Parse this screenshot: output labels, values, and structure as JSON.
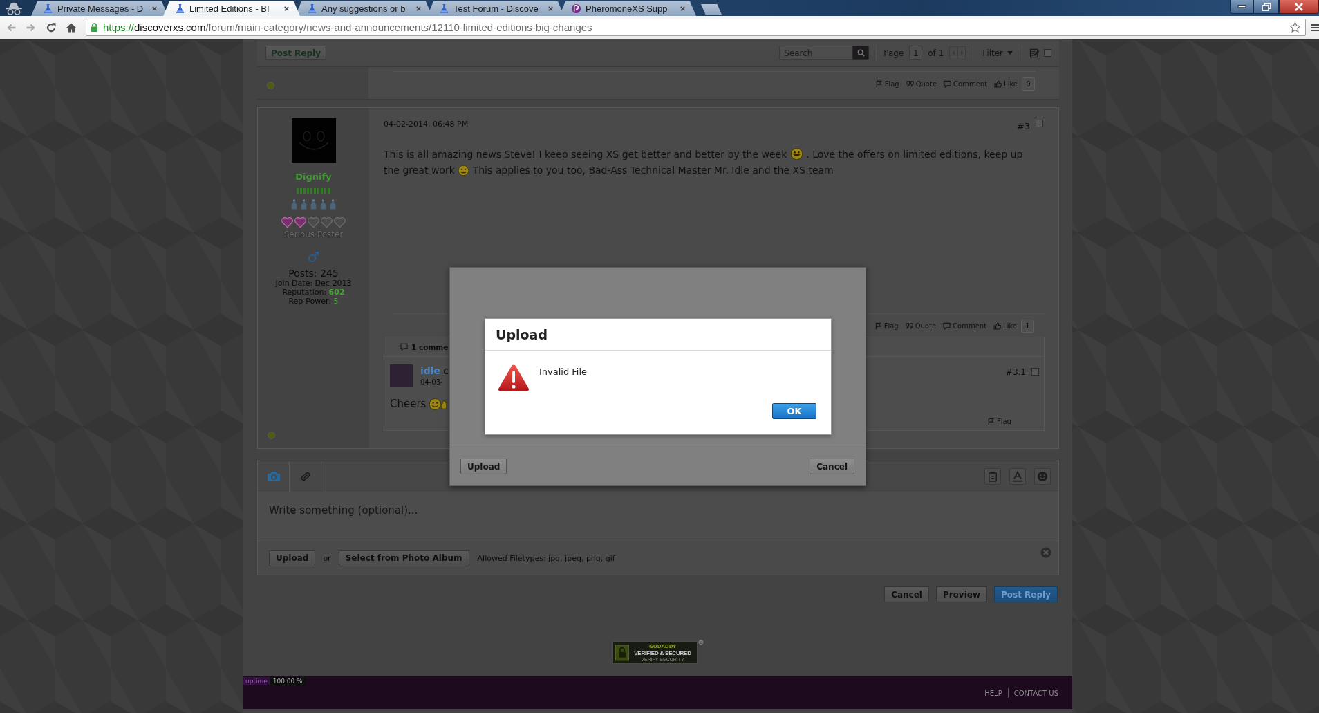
{
  "browser": {
    "tabs": [
      {
        "title": "Private Messages - D",
        "selected": false
      },
      {
        "title": "Limited Editions - BI",
        "selected": true
      },
      {
        "title": "Any suggestions or b",
        "selected": false
      },
      {
        "title": "Test Forum - Discove",
        "selected": false
      },
      {
        "title": "PheromoneXS Supp",
        "selected": false
      }
    ],
    "address": {
      "scheme": "https://",
      "host": "discoverxs.com",
      "path": "/forum/main-category/news-and-announcements/12110-limited-editions-big-changes"
    }
  },
  "toolbar": {
    "post_reply": "Post Reply",
    "search": {
      "placeholder": "Search"
    },
    "page": {
      "label": "Page",
      "value": "1",
      "total": "of 1"
    },
    "filter": "Filter",
    "checked": false
  },
  "previous_post": {
    "online": true,
    "actions": [
      {
        "kind": "flag",
        "label": "Flag"
      },
      {
        "kind": "quote",
        "label": "Quote"
      },
      {
        "kind": "comment",
        "label": "Comment"
      },
      {
        "kind": "like",
        "label": "Like"
      }
    ],
    "like_count": "0"
  },
  "post": {
    "author": {
      "name": "Dignify",
      "stars": 2,
      "title": "Serious Poster",
      "stats": [
        {
          "kind": "posts",
          "label": "Posts:",
          "value": "245"
        },
        {
          "kind": "joined",
          "label": "Join Date:",
          "value": "Dec 2013"
        },
        {
          "kind": "reputation",
          "label": "Reputation:",
          "value": "602"
        },
        {
          "kind": "power",
          "label": "Rep-Power:",
          "value": "5"
        }
      ],
      "online": true
    },
    "date": "04-02-2014, 06:48 PM",
    "number": "#3",
    "selected": false,
    "body": [
      {
        "kind": "text",
        "text": "This is all amazing news Steve! I keep seeing XS get better and better by the week"
      },
      {
        "kind": "grin"
      },
      {
        "kind": "text",
        "text": ". Love the offers on limited editions, keep up"
      },
      {
        "kind": "text",
        "text": "the great work"
      },
      {
        "kind": "smile"
      },
      {
        "kind": "text",
        "text": "This applies to you too, Bad-Ass Technical Master Mr. Idle and the XS team"
      }
    ],
    "actions": [
      {
        "kind": "flag",
        "label": "Flag"
      },
      {
        "kind": "quote",
        "label": "Quote"
      },
      {
        "kind": "comment",
        "label": "Comment"
      },
      {
        "kind": "like",
        "label": "Like"
      }
    ],
    "like_count": "1",
    "comments": {
      "header": "1 comme",
      "items": [
        {
          "author": "idle",
          "byline": "c",
          "date": "04-03-",
          "body": [
            {
              "kind": "text",
              "text": "Cheers"
            },
            {
              "kind": "wave"
            }
          ],
          "number": "#3.1",
          "selected": false,
          "actions": [
            {
              "kind": "flag",
              "label": "Flag"
            }
          ]
        }
      ]
    }
  },
  "editor": {
    "placeholder": "Write something (optional)...",
    "upload": "Upload",
    "or": "or",
    "album": "Select from Photo Album",
    "filetypes": "Allowed Filetypes: jpg, jpeg, png, gif"
  },
  "form_buttons": [
    {
      "label": "Cancel",
      "kind": "plain"
    },
    {
      "label": "Preview",
      "kind": "plain"
    },
    {
      "label": "Post Reply",
      "kind": "primary"
    }
  ],
  "seal": {
    "brand": "GODADDY",
    "headline": "VERIFIED & SECURED",
    "link": "VERIFY SECURITY",
    "mark": "®"
  },
  "footer": {
    "badge": "uptime",
    "zoom": "100.00 %",
    "links": [
      "HELP",
      "CONTACT US"
    ]
  },
  "upload_dialog": {
    "upload": "Upload",
    "cancel": "Cancel",
    "alert": {
      "title": "Upload",
      "message": "Invalid File",
      "button": "OK"
    }
  }
}
